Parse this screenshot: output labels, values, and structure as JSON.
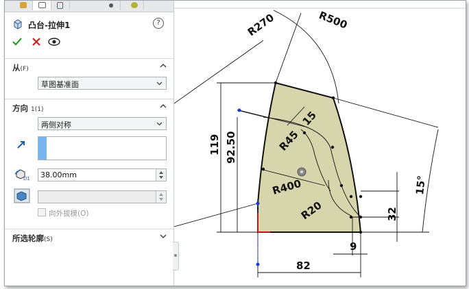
{
  "feature": {
    "title": "凸台-拉伸1",
    "help_symbol": "?"
  },
  "sections": {
    "from": {
      "title": "从",
      "suffix": "(F)",
      "value": "草图基准面"
    },
    "direction1": {
      "title": "方向",
      "suffix": "1(1)",
      "end_condition": "两侧对称",
      "depth": "38.00mm",
      "draft_outward_label": "向外拔模(O)"
    },
    "selected_contours": {
      "title": "所选轮廓",
      "suffix": "(S)"
    }
  },
  "sketch": {
    "dimensions": {
      "r270": "R270",
      "r500": "R500",
      "r45": "R45",
      "d15": "15",
      "r400": "R400",
      "r20": "R20",
      "d119": "119",
      "d92_50": "92.50",
      "angle15": "15°",
      "d32": "32",
      "d9": "9",
      "d82": "82"
    }
  },
  "colors": {
    "profile_fill": "#d6d5ac",
    "selection_blue": "#7ab6ee",
    "ok_green": "#2e9a2e",
    "cancel_red": "#d02020"
  }
}
